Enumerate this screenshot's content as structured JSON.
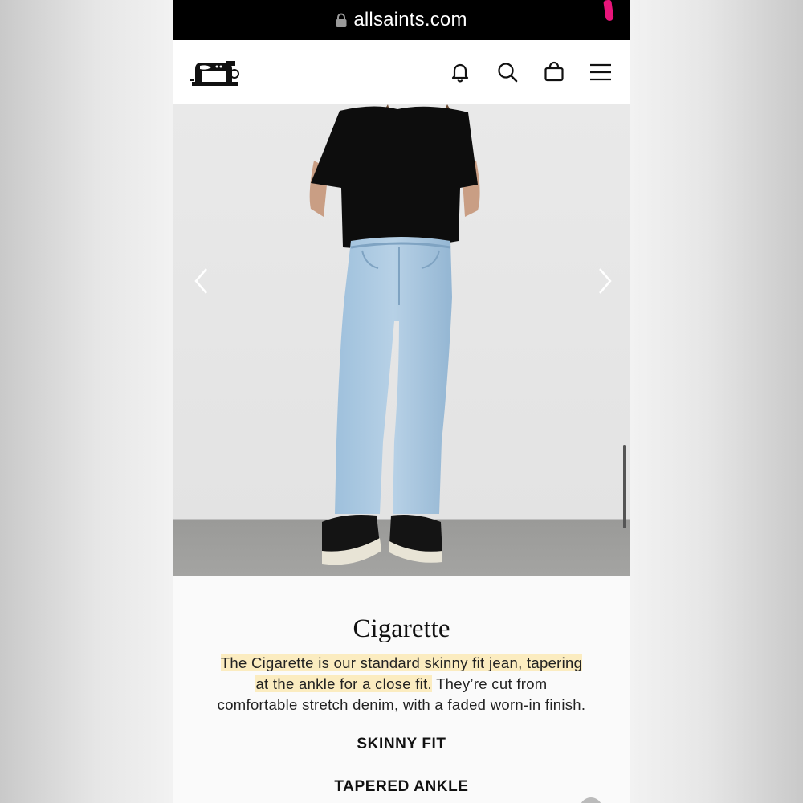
{
  "browser": {
    "url": "allsaints.com"
  },
  "header": {
    "logo_icon": "sewing-machine-logo",
    "icons": [
      "bell-icon",
      "search-icon",
      "shopping-bag-icon",
      "hamburger-menu-icon"
    ]
  },
  "carousel": {
    "image": "model-wearing-light-blue-skinny-jeans",
    "prev_icon": "chevron-left-icon",
    "next_icon": "chevron-right-icon"
  },
  "product": {
    "title": "Cigarette",
    "description_highlight_line1": "The Cigarette is our standard skinny fit jean, tapering",
    "description_highlight_line2": "at the ankle for a close fit.",
    "description_rest_line2": " They’re cut from",
    "description_line3": "comfortable stretch denim, with a faded worn-in finish.",
    "features": [
      "SKINNY FIT",
      "TAPERED ANKLE"
    ]
  },
  "colors": {
    "highlight": "#fbecc0",
    "address_bar": "#000000",
    "text": "#111111"
  }
}
